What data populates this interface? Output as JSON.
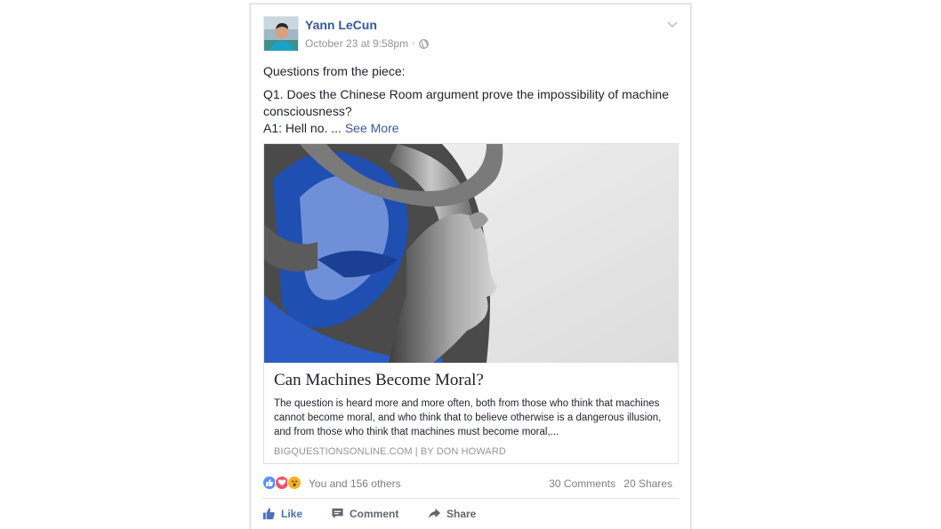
{
  "post": {
    "author": "Yann LeCun",
    "timestamp": "October 23 at 9:58pm",
    "separator": "·",
    "privacy_icon": "globe-icon",
    "menu_icon": "chevron-down-icon",
    "text": {
      "intro": "Questions from the piece:",
      "q1": "Q1. Does the Chinese Room argument prove the impossibility of machine consciousness?",
      "a1": "A1: Hell no. ...",
      "see_more": "See More"
    }
  },
  "link_preview": {
    "title": "Can Machines Become Moral?",
    "description": "The question is heard more and more often, both from those who think that machines cannot become moral, and who think that to believe otherwise is a dangerous illusion, and from those who think that machines must become moral,...",
    "source": "BIGQUESTIONSONLINE.COM",
    "byline": "BY DON HOWARD",
    "source_separator": "|",
    "image_alt": "sculpture of a head intertwined with a blue-tinted twisted metal strip"
  },
  "reactions": {
    "icons": [
      "like-reaction-icon",
      "love-reaction-icon",
      "wow-reaction-icon"
    ],
    "summary": "You and 156 others",
    "comments": "30 Comments",
    "shares": "20 Shares"
  },
  "actions": {
    "like": "Like",
    "comment": "Comment",
    "share": "Share"
  },
  "colors": {
    "link_blue": "#365899",
    "like_blue": "#4b6fbb",
    "meta_gray": "#90949c",
    "border": "#dddfe2",
    "love_red": "#f25268",
    "wow_yellow": "#f7b125"
  }
}
